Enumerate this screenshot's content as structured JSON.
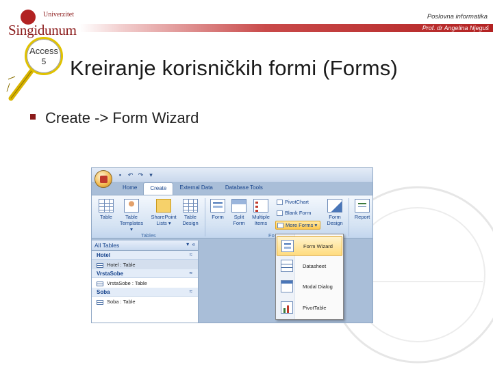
{
  "header": {
    "logo_top": "Univerzitet",
    "logo_main": "Singidunum",
    "course": "Poslovna informatika",
    "author": "Prof. dr Angelina Njeguš"
  },
  "badge": {
    "line1": "Access",
    "line2": "5"
  },
  "slide": {
    "title": "Kreiranje korisničkih formi (Forms)",
    "bullet": "Create -> Form Wizard"
  },
  "colors": {
    "brand_red": "#b32222",
    "ribbon_blue": "#15428b",
    "highlight": "#ffc94d"
  },
  "app": {
    "tabs": [
      {
        "label": "Home"
      },
      {
        "label": "Create",
        "active": true
      },
      {
        "label": "External Data"
      },
      {
        "label": "Database Tools"
      }
    ],
    "ribbon": {
      "tables": [
        "Table",
        "Table Templates ▾",
        "SharePoint Lists ▾",
        "Table Design"
      ],
      "tables_group": "Tables",
      "forms": [
        "Form",
        "Split Form",
        "Multiple Items"
      ],
      "small": {
        "pivot_chart": "PivotChart",
        "blank_form": "Blank Form",
        "more_forms": "More Forms ▾"
      },
      "form_design": "Form Design",
      "forms_group": "Fo",
      "report": "Report"
    },
    "nav": {
      "header": "All Tables",
      "groups": [
        {
          "name": "Hotel",
          "items": [
            "Hotel : Table"
          ]
        },
        {
          "name": "VrstaSobe",
          "items": [
            "VrstaSobe : Table"
          ]
        },
        {
          "name": "Soba",
          "items": [
            "Soba : Table"
          ]
        }
      ]
    },
    "dropdown": [
      "Form Wizard",
      "Datasheet",
      "Modal Dialog",
      "PivotTable"
    ]
  }
}
